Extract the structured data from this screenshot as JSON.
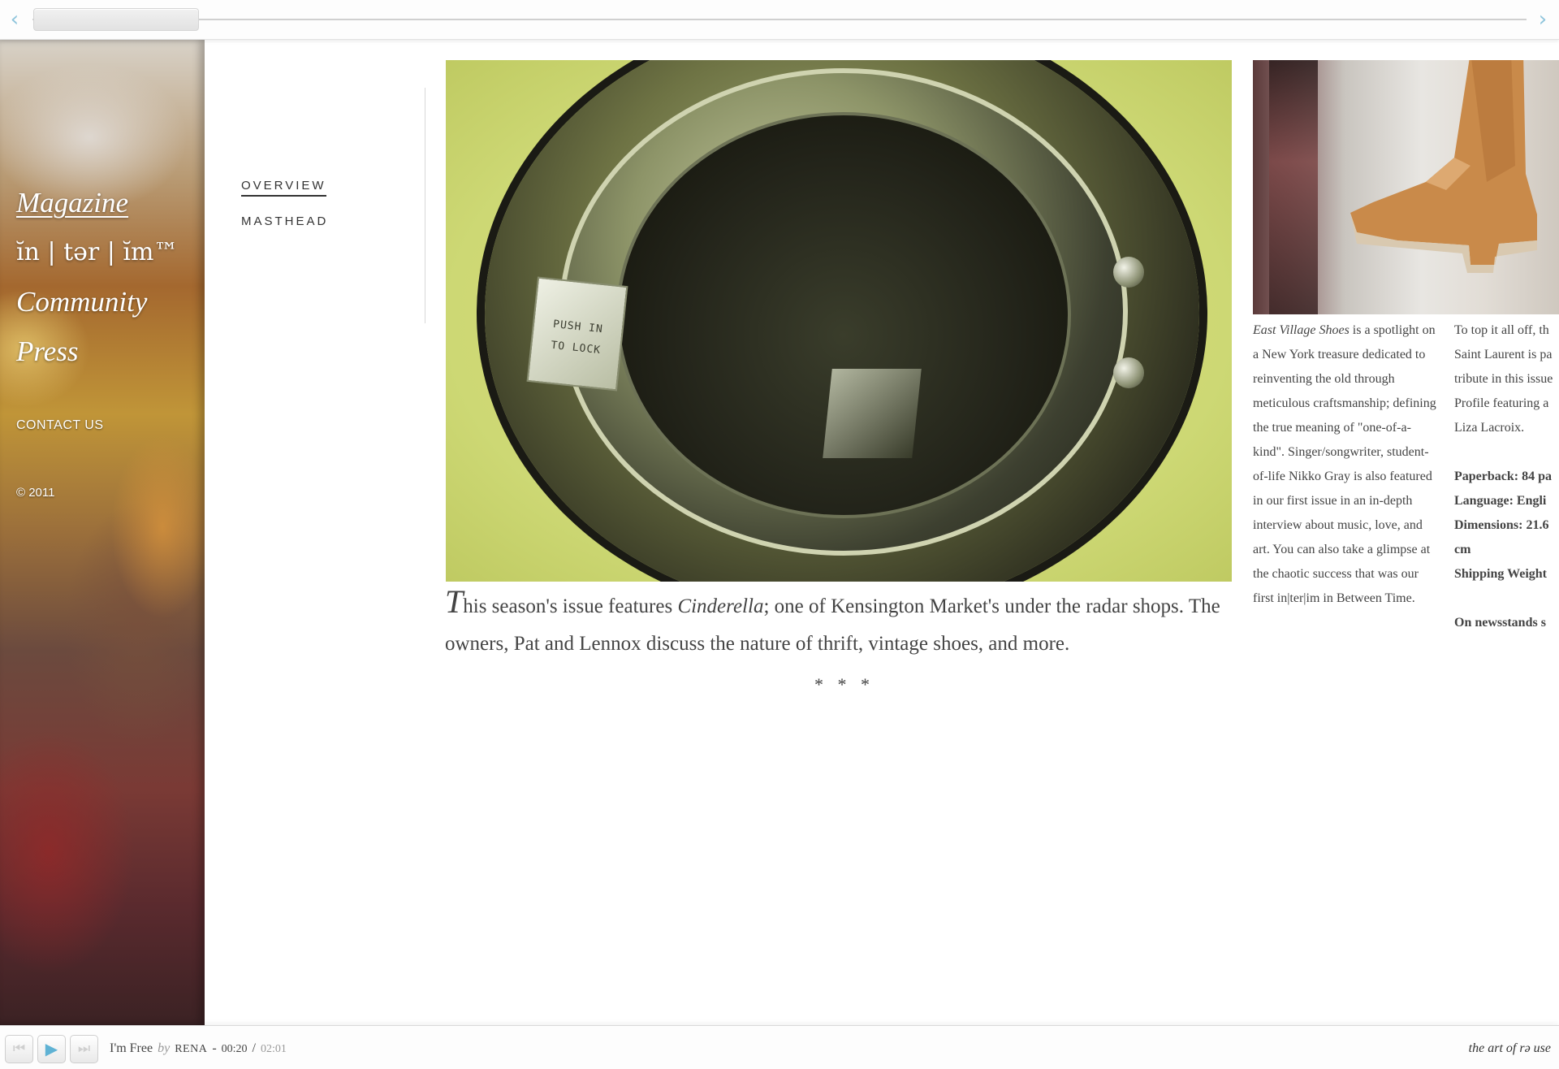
{
  "scroller": {
    "position": 0.0
  },
  "sidebar": {
    "nav": [
      "Magazine",
      "ĭn | tər | ĭm™",
      "Community",
      "Press"
    ],
    "contact": "CONTACT US",
    "copyright": "© 2011"
  },
  "subnav": {
    "items": [
      "OVERVIEW",
      "MASTHEAD"
    ],
    "active": "OVERVIEW"
  },
  "photo": {
    "latch_line1": "PUSH IN",
    "latch_line2": "TO LOCK"
  },
  "caption": {
    "dropcap": "T",
    "part1": "his season's issue features ",
    "emph": "Cinderella",
    "part2": "; one of Kensington Market's under the radar shops. The owners, Pat and Lennox discuss the nature of thrift, vintage shoes, and more."
  },
  "separator": "* * *",
  "column1": {
    "lead_emph": "East Village Shoes",
    "text": " is a spotlight on a New York treasure dedicated to reinventing the old through meticulous craftsmanship; defining the true meaning of \"one-of-a-kind\". Singer/songwriter, student-of-life Nikko Gray is also featured in our first issue in an in-depth interview about music, love, and art. You can also take a glimpse at the chaotic success that was our first in|ter|im in Between Time."
  },
  "column2": {
    "lines": [
      "To top it all off, th",
      "Saint Laurent is pa",
      "tribute in this issue",
      "Profile featuring a",
      "Liza Lacroix."
    ],
    "specs": [
      "Paperback: 84 pa",
      "Language: Engli",
      "Dimensions: 21.6",
      "cm",
      "Shipping Weight"
    ],
    "footer": "On newsstands s"
  },
  "player": {
    "title": "I'm Free",
    "by": "by",
    "artist": "RENA",
    "separator": "-",
    "current": "00:20",
    "slash": "/",
    "total": "02:01",
    "tagline": "the art of rə use"
  }
}
